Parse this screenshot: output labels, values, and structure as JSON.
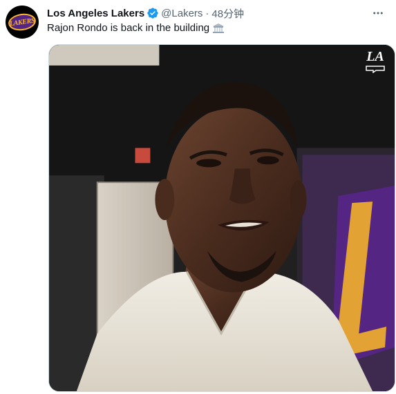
{
  "tweet": {
    "author_name": "Los Angeles Lakers",
    "handle": "@Lakers",
    "separator": "·",
    "time": "48分钟",
    "text": "Rajon Rondo is back in the building",
    "verified": true,
    "icons": {
      "verified": "verified-badge-icon",
      "more": "more-options-icon",
      "emoji": "classical-building-emoji-icon"
    }
  },
  "avatar": {
    "logo_text": "LAKERS"
  },
  "media": {
    "watermark_text": "LA"
  },
  "colors": {
    "verified": "#1d9bf0",
    "lakers_purple": "#552583",
    "lakers_gold": "#fdb927",
    "secondary_text": "#536471"
  }
}
